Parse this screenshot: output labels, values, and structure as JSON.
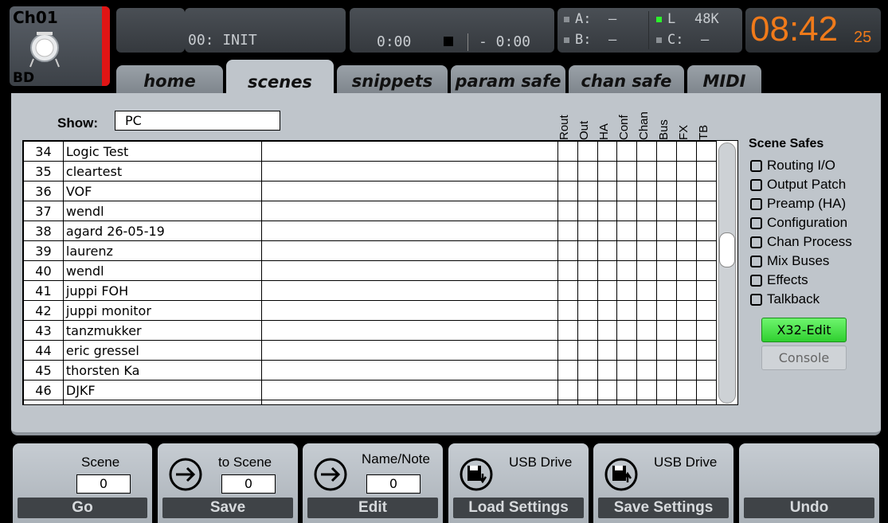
{
  "channel": {
    "name": "Ch01",
    "label": "BD",
    "icon": "kick-drum-icon"
  },
  "status": {
    "scene_display": "00: INIT",
    "time_elapsed": "0:00",
    "time_remaining": "- 0:00",
    "usb_a_label": "A:",
    "usb_a_value": "–",
    "usb_b_label": "B:",
    "usb_b_value": "–",
    "l_label": "L",
    "samplerate": "48K",
    "c_label": "C:",
    "c_value": "–"
  },
  "clock": {
    "hm": "08:42",
    "sec": "25"
  },
  "tabs": [
    "home",
    "scenes",
    "snippets",
    "param safe",
    "chan safe",
    "MIDI"
  ],
  "show": {
    "label": "Show:",
    "value": "PC"
  },
  "columns": [
    "Rout",
    "Out",
    "HA",
    "Conf",
    "Chan",
    "Bus",
    "FX",
    "TB"
  ],
  "scenes": [
    {
      "num": "34",
      "name": "Logic Test"
    },
    {
      "num": "35",
      "name": "cleartest"
    },
    {
      "num": "36",
      "name": "VOF"
    },
    {
      "num": "37",
      "name": "wendl"
    },
    {
      "num": "38",
      "name": "agard 26-05-19"
    },
    {
      "num": "39",
      "name": "laurenz"
    },
    {
      "num": "40",
      "name": "wendl"
    },
    {
      "num": "41",
      "name": "juppi FOH"
    },
    {
      "num": "42",
      "name": "juppi monitor"
    },
    {
      "num": "43",
      "name": "tanzmukker"
    },
    {
      "num": "44",
      "name": "eric gressel"
    },
    {
      "num": "45",
      "name": "thorsten Ka"
    },
    {
      "num": "46",
      "name": "DJKF"
    }
  ],
  "scene_safes": {
    "title": "Scene Safes",
    "items": [
      "Routing I/O",
      "Output Patch",
      "Preamp (HA)",
      "Configuration",
      "Chan Process",
      "Mix Buses",
      "Effects",
      "Talkback"
    ],
    "x32_edit": "X32-Edit",
    "console": "Console"
  },
  "bottom": [
    {
      "label": "Scene",
      "value": "0",
      "action": "Go"
    },
    {
      "label": "to Scene",
      "value": "0",
      "action": "Save"
    },
    {
      "label": "Name/Note",
      "value": "0",
      "action": "Edit"
    },
    {
      "label": "USB Drive",
      "action": "Load Settings"
    },
    {
      "label": "USB Drive",
      "action": "Save Settings"
    },
    {
      "action": "Undo"
    }
  ],
  "colors": {
    "accent_green": "#2fcf2f",
    "clock_orange": "#f07a1a",
    "channel_red": "#e01515"
  }
}
